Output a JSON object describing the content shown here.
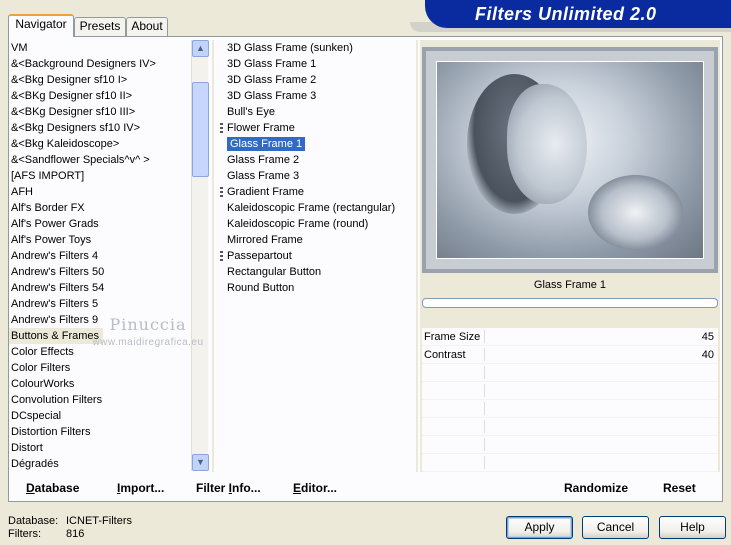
{
  "tabs": [
    "Navigator",
    "Presets",
    "About"
  ],
  "banner": {
    "title": "Filters Unlimited 2.0"
  },
  "categories": {
    "items": [
      "VM",
      "&<Background Designers IV>",
      "&<Bkg Designer sf10 I>",
      "&<BKg Designer sf10 II>",
      "&<BKg Designer sf10 III>",
      "&<Bkg Designers sf10 IV>",
      "&<Bkg Kaleidoscope>",
      "&<Sandflower Specials^v^ >",
      "[AFS IMPORT]",
      "AFH",
      "Alf's Border FX",
      "Alf's Power Grads",
      "Alf's Power Toys",
      "Andrew's Filters 4",
      "Andrew's Filters 50",
      "Andrew's Filters 54",
      "Andrew's Filters 5",
      "Andrew's Filters 9",
      "Buttons & Frames",
      "Color Effects",
      "Color Filters",
      "ColourWorks",
      "Convolution Filters",
      "DCspecial",
      "Distortion Filters",
      "Distort",
      "Dégradés"
    ],
    "selected_index": 18,
    "scroll_up": "▲",
    "scroll_down": "▼"
  },
  "filters": {
    "items": [
      {
        "label": "3D Glass Frame (sunken)",
        "mark": false
      },
      {
        "label": "3D Glass Frame 1",
        "mark": false
      },
      {
        "label": "3D Glass Frame 2",
        "mark": false
      },
      {
        "label": "3D Glass Frame 3",
        "mark": false
      },
      {
        "label": "Bull's Eye",
        "mark": false
      },
      {
        "label": "Flower Frame",
        "mark": true
      },
      {
        "label": "Glass Frame 1",
        "mark": false
      },
      {
        "label": "Glass Frame 2",
        "mark": false
      },
      {
        "label": "Glass Frame 3",
        "mark": false
      },
      {
        "label": "Gradient Frame",
        "mark": true
      },
      {
        "label": "Kaleidoscopic Frame (rectangular)",
        "mark": false
      },
      {
        "label": "Kaleidoscopic Frame (round)",
        "mark": false
      },
      {
        "label": "Mirrored Frame",
        "mark": false
      },
      {
        "label": "Passepartout",
        "mark": true
      },
      {
        "label": "Rectangular Button",
        "mark": false
      },
      {
        "label": "Round Button",
        "mark": false
      }
    ],
    "selected_index": 6
  },
  "preview": {
    "filter_name": "Glass Frame 1",
    "progress": 0
  },
  "params": [
    {
      "label": "Frame Size",
      "value": "45"
    },
    {
      "label": "Contrast",
      "value": "40"
    },
    {
      "label": "",
      "value": ""
    },
    {
      "label": "",
      "value": ""
    },
    {
      "label": "",
      "value": ""
    },
    {
      "label": "",
      "value": ""
    },
    {
      "label": "",
      "value": ""
    },
    {
      "label": "",
      "value": ""
    }
  ],
  "watermark": {
    "name": "Pinuccia",
    "url": "www.maidiregrafica.eu"
  },
  "toolbar": {
    "database": {
      "first": "D",
      "rest": "atabase"
    },
    "import": {
      "first": "I",
      "rest": "mport..."
    },
    "filter_info": {
      "pre": "Filter ",
      "first": "I",
      "rest": "nfo..."
    },
    "editor": {
      "first": "E",
      "rest": "ditor..."
    },
    "randomize": "Randomize",
    "reset": "Reset"
  },
  "status": {
    "database_label": "Database:",
    "database_value": "ICNET-Filters",
    "filters_label": "Filters:",
    "filters_value": "816"
  },
  "buttons": {
    "apply": "Apply",
    "cancel": "Cancel",
    "help": "Help"
  }
}
